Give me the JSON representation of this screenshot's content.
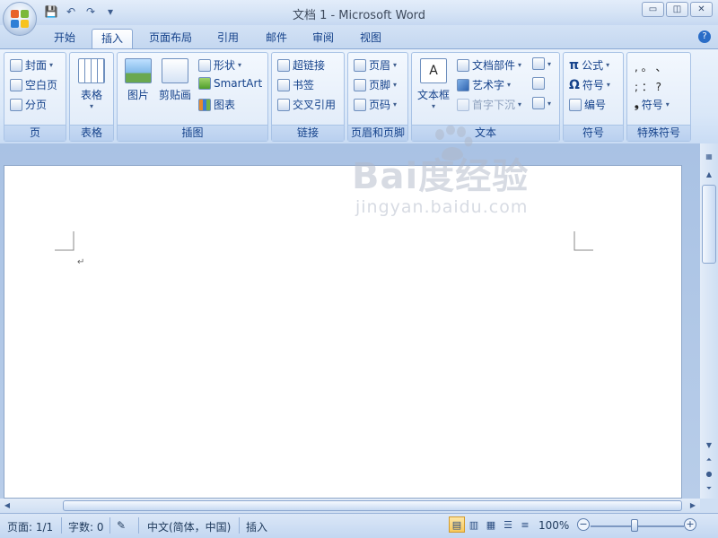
{
  "window": {
    "title": "文档 1 - Microsoft Word"
  },
  "qat": {
    "save": "💾",
    "undo": "↶",
    "redo": "↷",
    "more": "▾"
  },
  "window_buttons": {
    "minimize": "▭",
    "restore": "◫",
    "close": "✕"
  },
  "tabs": [
    "开始",
    "插入",
    "页面布局",
    "引用",
    "邮件",
    "审阅",
    "视图"
  ],
  "active_tab": "插入",
  "help": "?",
  "ribbon": {
    "pages": {
      "label": "页",
      "cover": "封面",
      "blank": "空白页",
      "break": "分页"
    },
    "table": {
      "label": "表格",
      "table": "表格"
    },
    "illustrations": {
      "label": "插图",
      "picture": "图片",
      "clipart": "剪贴画",
      "shapes": "形状",
      "smartart": "SmartArt",
      "chart": "图表"
    },
    "links": {
      "label": "链接",
      "hyperlink": "超链接",
      "bookmark": "书签",
      "crossref": "交叉引用"
    },
    "header_footer": {
      "label": "页眉和页脚",
      "header": "页眉",
      "footer": "页脚",
      "pagenum": "页码"
    },
    "text": {
      "label": "文本",
      "textbox": "文本框",
      "quickparts": "文档部件",
      "wordart": "艺术字",
      "dropcap": "首字下沉"
    },
    "symbols": {
      "label": "符号",
      "equation": "公式",
      "symbol": "符号",
      "numbering": "编号"
    },
    "special": {
      "label": "特殊符号",
      "chars1": ",   。  、",
      "chars2": ";   ：  ?",
      "symbol": "符号"
    }
  },
  "document": {
    "paragraph_mark": "↵"
  },
  "watermark": {
    "main": "Bai度经验",
    "sub": "jingyan.baidu.com"
  },
  "status": {
    "page": "页面: 1/1",
    "words": "字数: 0",
    "language": "中文(简体，中国)",
    "mode": "插入",
    "zoom": "100%"
  },
  "colors": {
    "accent": "#15428b",
    "ribbon_bg": "#dfeaf8",
    "active_view": "#f9c95c"
  }
}
